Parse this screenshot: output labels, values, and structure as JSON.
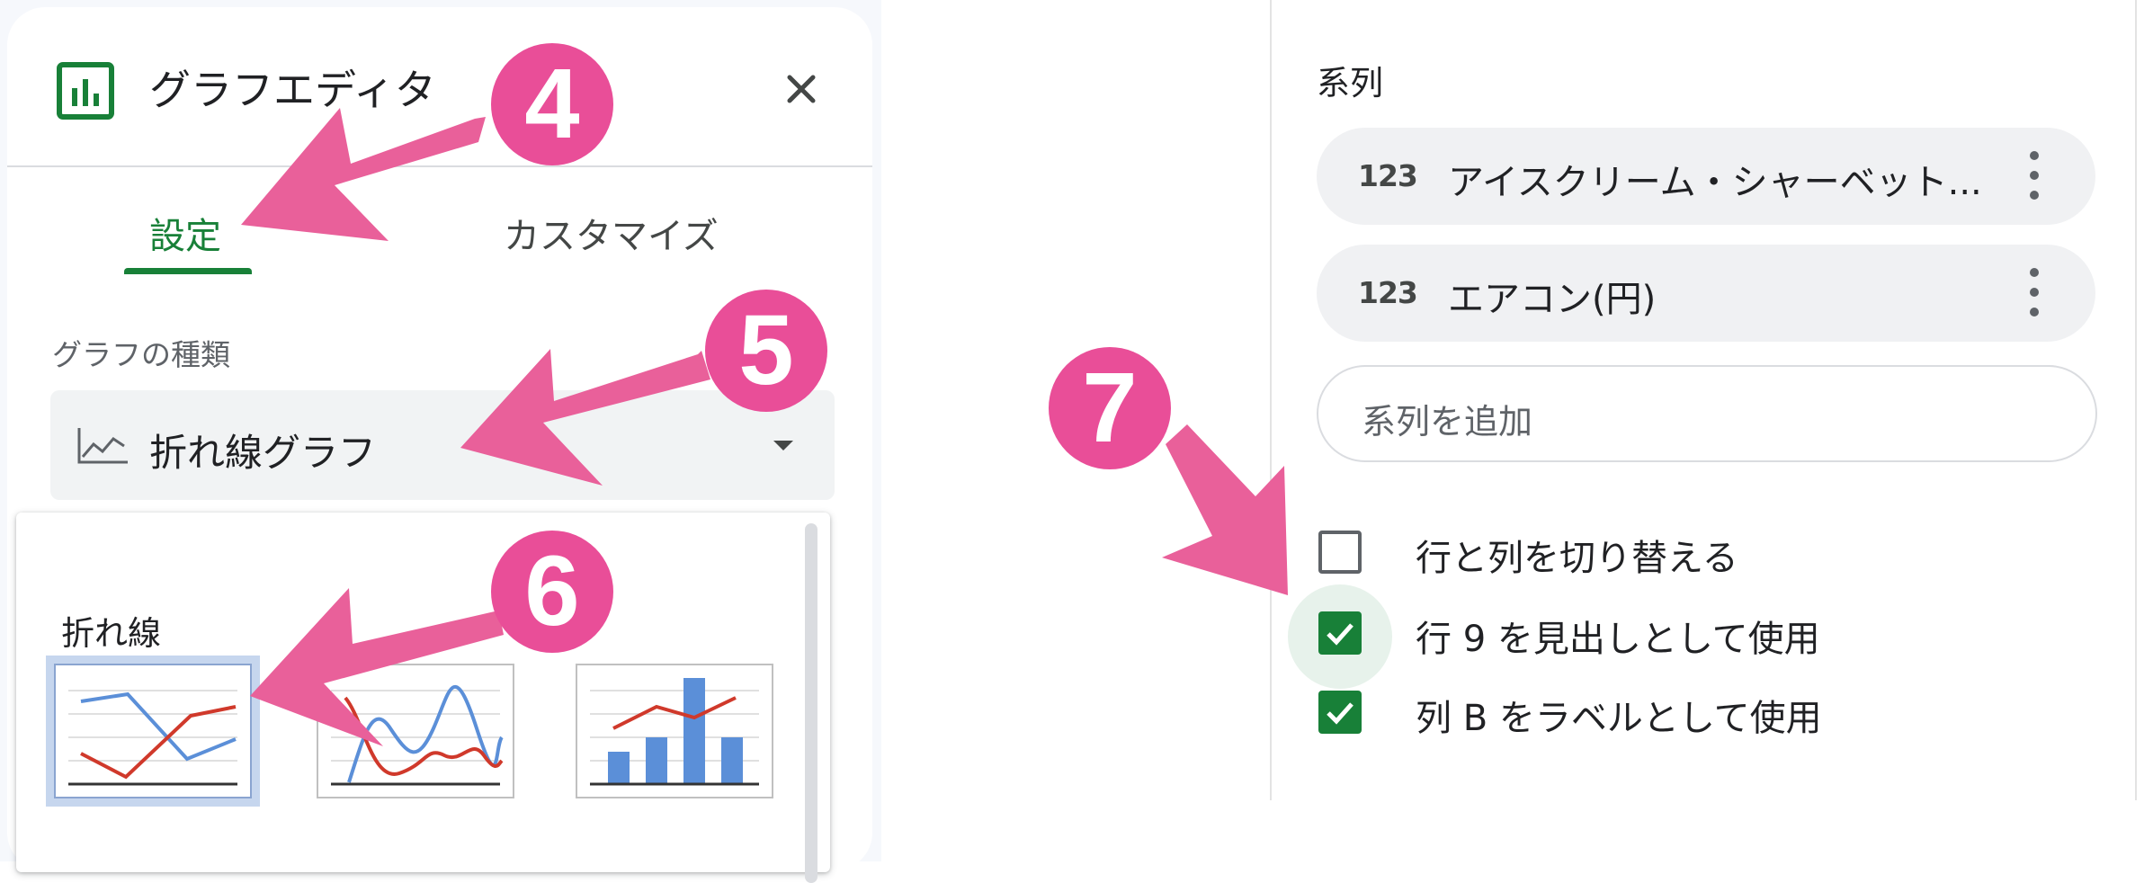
{
  "editor": {
    "title": "グラフエディタ",
    "icons": {
      "chart": "bar-chart-icon",
      "close": "close-icon"
    },
    "tabs": [
      {
        "label": "設定",
        "active": true
      },
      {
        "label": "カスタマイズ",
        "active": false
      }
    ],
    "chart_type": {
      "section_label": "グラフの種類",
      "selected": "折れ線グラフ"
    },
    "dropdown": {
      "group_label": "折れ線",
      "options": [
        {
          "name": "line-chart",
          "selected": true
        },
        {
          "name": "smooth-line-chart",
          "selected": false
        },
        {
          "name": "combo-chart",
          "selected": false
        }
      ]
    }
  },
  "series_panel": {
    "label": "系列",
    "series": [
      {
        "type": "123",
        "name": "アイスクリーム・シャーベット..."
      },
      {
        "type": "123",
        "name": "エアコン(円)"
      }
    ],
    "add_placeholder": "系列を追加",
    "options": [
      {
        "label": "行と列を切り替える",
        "checked": false
      },
      {
        "label": "行 9 を見出しとして使用",
        "checked": true
      },
      {
        "label": "列 B をラベルとして使用",
        "checked": true
      }
    ]
  },
  "annotations": {
    "badges": [
      "4",
      "5",
      "6",
      "7"
    ],
    "color": "#e94e98"
  },
  "colors": {
    "accent_green": "#188038",
    "line_blue": "#5b8fd8",
    "line_red": "#d0392b"
  }
}
